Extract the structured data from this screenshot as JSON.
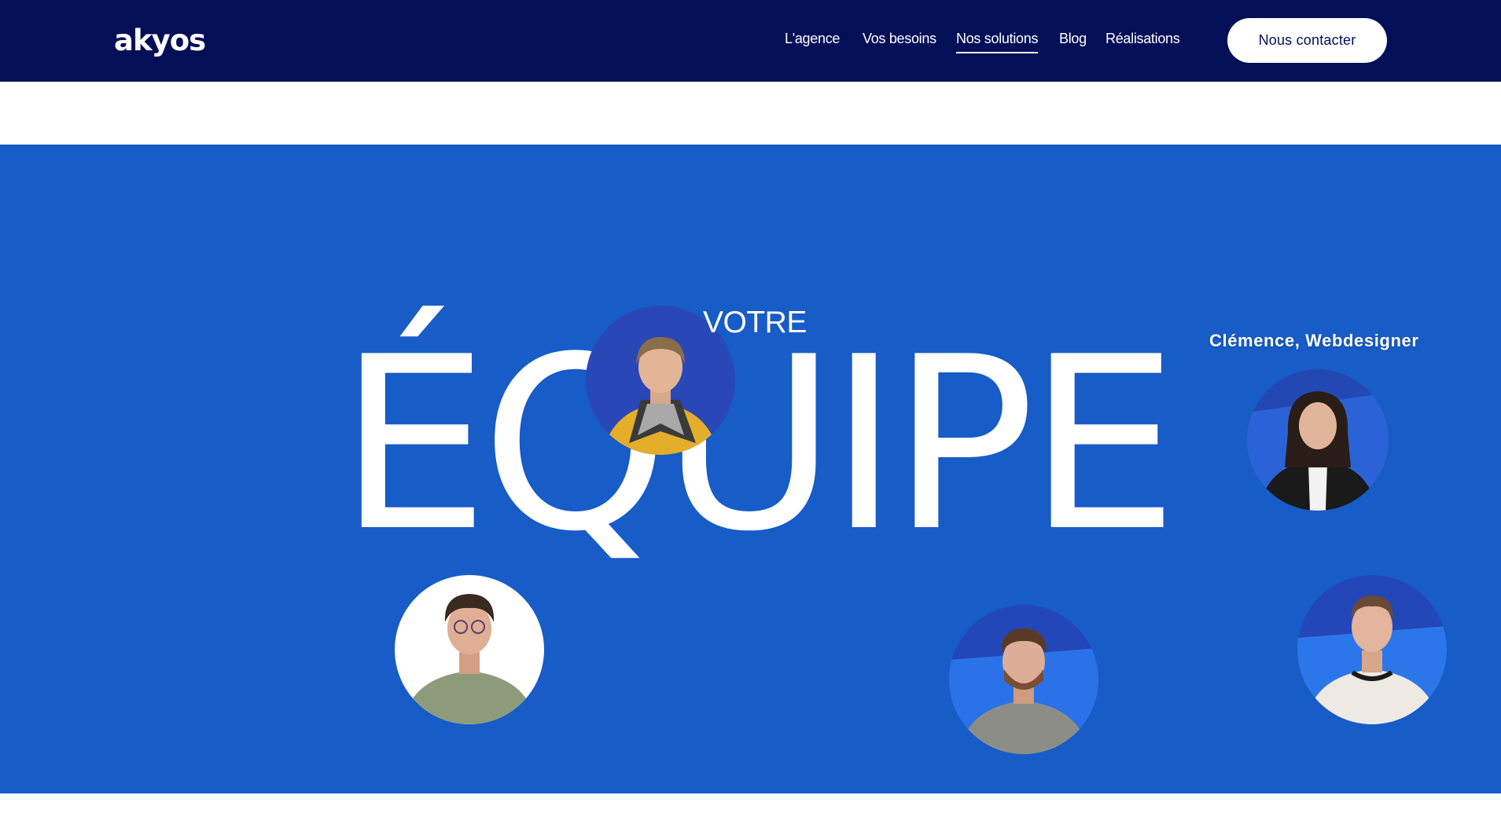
{
  "header": {
    "logo": "akyos",
    "nav": [
      {
        "label": "L'agence"
      },
      {
        "label": "Vos besoins"
      },
      {
        "label": "Nos solutions"
      },
      {
        "label": "Blog"
      },
      {
        "label": "Réalisations"
      }
    ],
    "cta_label": "Nous contacter"
  },
  "hero": {
    "kicker": "VOTRE",
    "title": "ÉQUIPE",
    "member_label": "Clémence, Webdesigner"
  },
  "colors": {
    "header_bg": "#030f57",
    "hero_bg": "#175cc7",
    "accent_light": "#1f72e6"
  }
}
